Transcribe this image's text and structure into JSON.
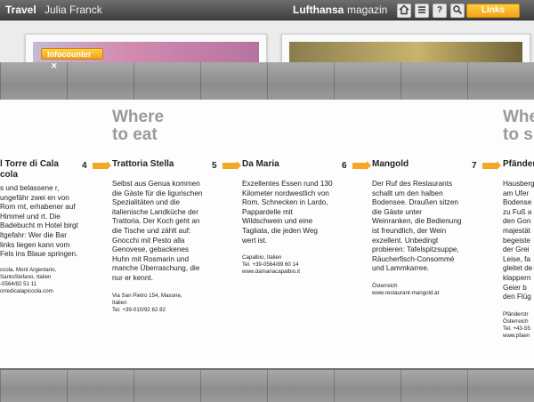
{
  "header": {
    "section": "Travel",
    "author": "Julia Franck",
    "brand": "Lufthansa",
    "brand_suffix": "magazin",
    "links_label": "Links",
    "help_label": "?"
  },
  "colors": {
    "accent": "#f5a623",
    "heading": "#9a9a9a",
    "bar": "#4a4a4a"
  },
  "infocounter": {
    "label": "Infocounter",
    "close": "✕"
  },
  "headings": {
    "left": [
      "Where",
      "to eat"
    ],
    "right": [
      "Whe",
      "to s"
    ]
  },
  "entries": [
    {
      "title": "l Torre di Cala cola",
      "body": "s und belassene r, ungefähr zwei en von Rom rnt, erhabener auf Himmel und rt. Die Badebucht m Hotel birgt ltgefahr: Wer die Bar links liegen kann vom Fels ins Blaue springen.",
      "addr": [
        "ccola, Mont Argentario,",
        "SantoStefano, Italien",
        "-0564/82 51 11",
        "orredicalapiccola.com"
      ]
    },
    {
      "number": "4",
      "title": "Trattoria Stella",
      "body": "Selbst aus Genua kommen die Gäste für die ligurischen Spezialitäten und die italienische Landküche der Trattoria. Der Koch geht an die Tische und zählt auf: Gnocchi mit Pesto alla Genovese, gebackenes Huhn mit Rosmarin und manche Überraschung, die nur er kennt.",
      "addr": [
        "Via San Pietro 154, Masone,",
        "Italien",
        "Tel. +39-010/92 62 82"
      ]
    },
    {
      "number": "5",
      "title": "Da Maria",
      "body": "Exzellentes Essen rund 130 Kilometer nordwestlich von Rom. Schnecken in Lardo, Pappardelle mit Wildschwein und eine Tagliata, die jeden Weg wert ist.",
      "addr": [
        "Capalbio, Italien",
        "Tel. +39-0564/89 60 14",
        "www.damariacapalbio.it"
      ]
    },
    {
      "number": "6",
      "title": "Mangold",
      "body": "Der Ruf des Restaurants schallt um den halben Bodensee. Draußen sitzen die Gäste unter Weinranken, die Bedienung ist freundlich, der Wein exzellent. Unbedingt probieren: Tafelspitzsuppe, Räucherfisch-Consommé und Lammkarree.",
      "addr": [
        "Österreich",
        "www.restaurant-mangold.at"
      ]
    },
    {
      "number": "7",
      "title": "Pfänder",
      "body": "Hausberg am Ufer Bodense zu Fuß a den Gon majestät begeiste der Grei Leise, fa gleitet de klappern Geier b den Flüg",
      "addr": [
        "Pfänderstr",
        "Österreich",
        "Tel. +43-55",
        "www.pfaen"
      ]
    }
  ]
}
